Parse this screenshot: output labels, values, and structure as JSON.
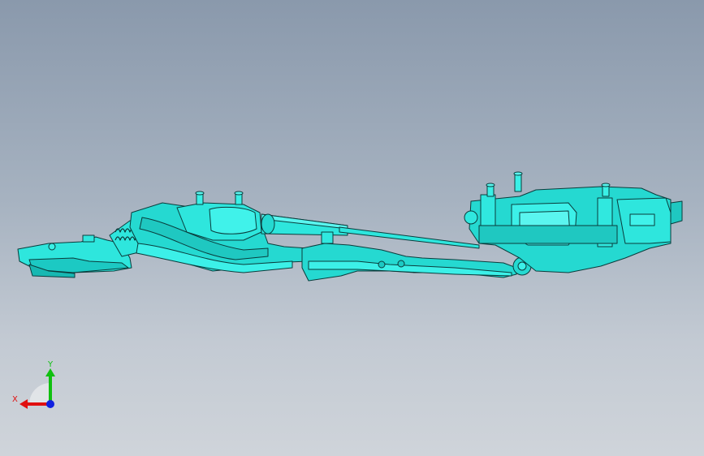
{
  "viewport": {
    "background_top": "#8a99ac",
    "background_bottom": "#cfd4da",
    "model_color": "#22e0d8",
    "model_edge_color": "#0a3c3c"
  },
  "triad": {
    "x_label": "X",
    "y_label": "Y",
    "x_color": "#e01010",
    "y_color": "#10c010",
    "z_color": "#1020e0"
  }
}
